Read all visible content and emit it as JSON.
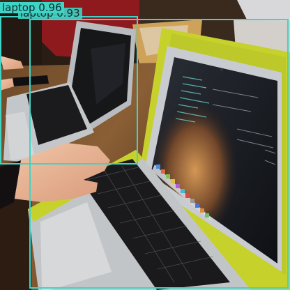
{
  "detections": [
    {
      "label": "laptop",
      "score": "0.96"
    },
    {
      "label": "laptop",
      "score": "0.93"
    }
  ],
  "screen_ui": {
    "dock_icon_names": [
      "finder-icon",
      "app-icon",
      "app-icon",
      "app-icon",
      "app-icon",
      "app-icon",
      "app-icon",
      "app-icon",
      "app-icon",
      "app-icon",
      "app-icon"
    ]
  },
  "colors": {
    "box": "#3fd4c6",
    "case": "#c9d52d",
    "aluminum": "#bfc3c6",
    "keys": "#151517"
  }
}
